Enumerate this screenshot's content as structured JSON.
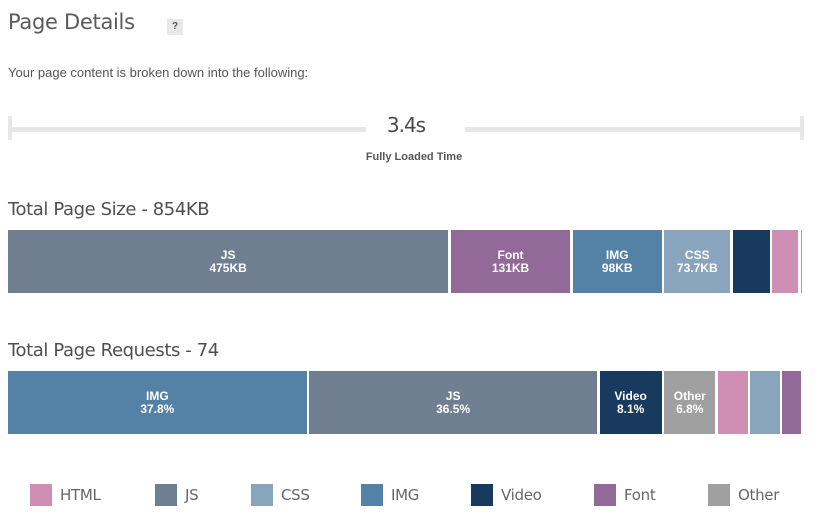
{
  "header": {
    "title": "Page Details",
    "help_label": "?",
    "subtitle": "Your page content is broken down into the following:"
  },
  "timeline": {
    "value": "3.4s",
    "label": "Fully Loaded Time"
  },
  "colors": {
    "HTML": "#cf8eb4",
    "JS": "#6f7f91",
    "CSS": "#88a5bd",
    "IMG": "#5481a6",
    "Video": "#183a5e",
    "Font": "#93699a",
    "Other": "#a0a0a0"
  },
  "chart_data": [
    {
      "type": "bar",
      "orientation": "horizontal-stacked",
      "title": "Total Page Size - 854KB",
      "total_kb": 854,
      "categories": [
        "JS",
        "Font",
        "IMG",
        "CSS",
        "Video",
        "HTML",
        "Other"
      ],
      "values": [
        475,
        131,
        98,
        73.7,
        42,
        31,
        3.3
      ],
      "labels": [
        "475KB",
        "131KB",
        "98KB",
        "73.7KB",
        "",
        "",
        ""
      ],
      "units": "KB"
    },
    {
      "type": "bar",
      "orientation": "horizontal-stacked",
      "title": "Total Page Requests - 74",
      "total": 74,
      "categories": [
        "IMG",
        "JS",
        "Video",
        "Other",
        "HTML",
        "CSS",
        "Font"
      ],
      "values": [
        28,
        27,
        6,
        5,
        3,
        3,
        2
      ],
      "percent": [
        37.8,
        36.5,
        8.1,
        6.8,
        4.1,
        4.1,
        2.7
      ],
      "labels": [
        "37.8%",
        "36.5%",
        "8.1%",
        "6.8%",
        "",
        "",
        ""
      ],
      "units": "requests"
    }
  ],
  "legend": [
    {
      "name": "HTML"
    },
    {
      "name": "JS"
    },
    {
      "name": "CSS"
    },
    {
      "name": "IMG"
    },
    {
      "name": "Video"
    },
    {
      "name": "Font"
    },
    {
      "name": "Other"
    }
  ]
}
